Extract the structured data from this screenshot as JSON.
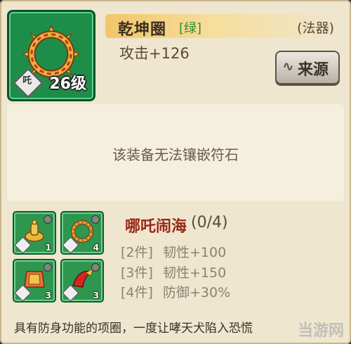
{
  "item": {
    "name": "乾坤圈",
    "quality": "[绿]",
    "type": "(法器)",
    "stat": "攻击+126",
    "level_label": "26级",
    "role_glyph": "吒",
    "icon": "golden-ring-icon"
  },
  "source_button": {
    "label": "来源",
    "icon": "swirl-icon"
  },
  "gem_info": {
    "text": "该装备无法镶嵌符石"
  },
  "set": {
    "name": "哪吒闹海",
    "progress": "(0/4)",
    "pieces": [
      {
        "icon": "golden-lamp-icon",
        "count": "1"
      },
      {
        "icon": "golden-ring-icon",
        "count": "4"
      },
      {
        "icon": "red-armor-icon",
        "count": "3"
      },
      {
        "icon": "red-sash-icon",
        "count": "3"
      }
    ],
    "bonuses": [
      {
        "pieces": "[2件]",
        "effect": "韧性+100"
      },
      {
        "pieces": "[3件]",
        "effect": "韧性+150"
      },
      {
        "pieces": "[4件]",
        "effect": "防御+30%"
      }
    ]
  },
  "description": "具有防身功能的项圈，一度让哮天犬陷入恐慌",
  "watermark": "当游网",
  "colors": {
    "quality_green": "#2e8b2e",
    "set_name_red": "#9a2818",
    "slot_green": "#2f9650"
  }
}
